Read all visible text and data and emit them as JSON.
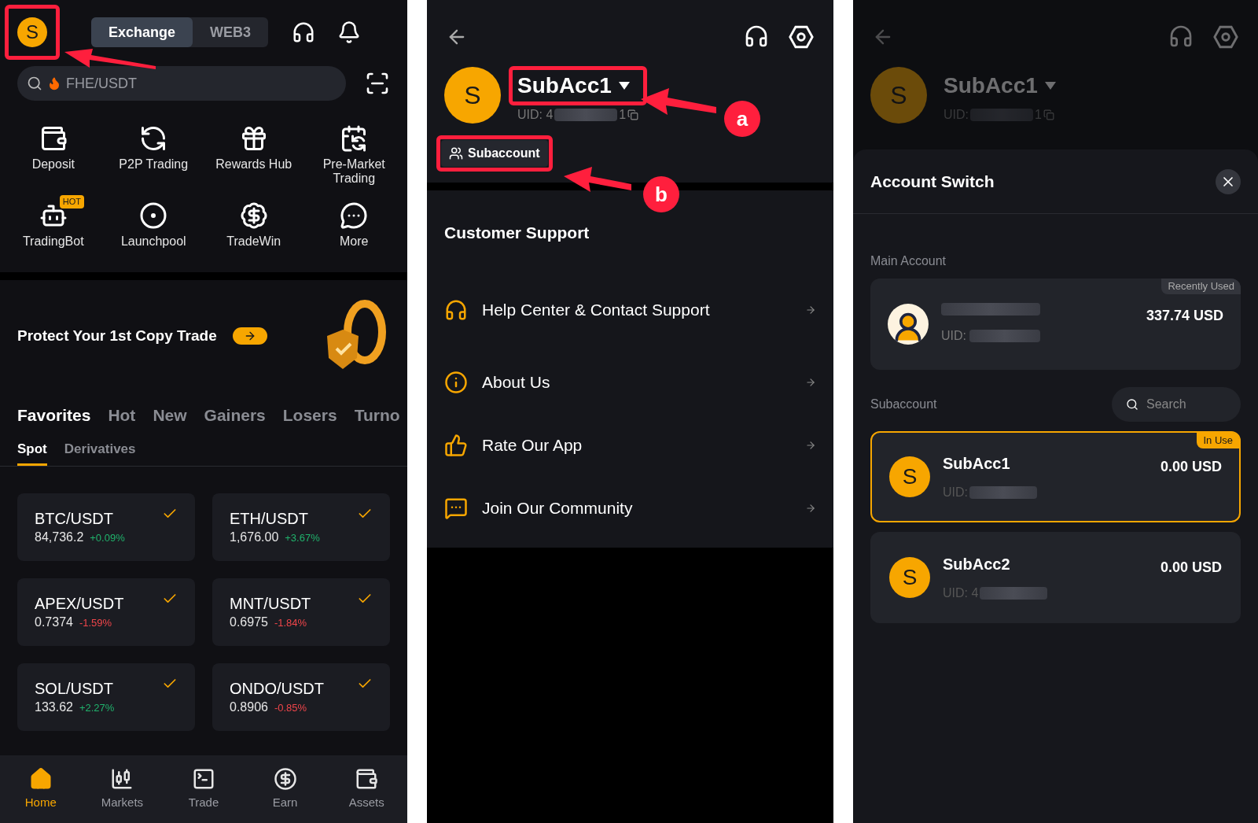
{
  "home": {
    "avatar_letter": "S",
    "mode_tabs": [
      {
        "label": "Exchange",
        "selected": true
      },
      {
        "label": "WEB3",
        "selected": false
      }
    ],
    "search": {
      "placeholder": "FHE/USDT"
    },
    "quick_actions": [
      {
        "label": "Deposit"
      },
      {
        "label": "P2P Trading"
      },
      {
        "label": "Rewards Hub"
      },
      {
        "label": "Pre-Market Trading"
      },
      {
        "label": "TradingBot",
        "badge": "HOT"
      },
      {
        "label": "Launchpool"
      },
      {
        "label": "TradeWin"
      },
      {
        "label": "More"
      }
    ],
    "banner": {
      "text": "Protect Your 1st Copy Trade"
    },
    "market_tabs": [
      {
        "label": "Favorites",
        "selected": true
      },
      {
        "label": "Hot",
        "selected": false
      },
      {
        "label": "New",
        "selected": false
      },
      {
        "label": "Gainers",
        "selected": false
      },
      {
        "label": "Losers",
        "selected": false
      },
      {
        "label": "Turno",
        "selected": false
      }
    ],
    "sub_tabs": [
      {
        "label": "Spot",
        "selected": true
      },
      {
        "label": "Derivatives",
        "selected": false
      }
    ],
    "pairs": [
      {
        "pair": "BTC/USDT",
        "price": "84,736.2",
        "change": "+0.09%",
        "color": "#20b26c",
        "favorite": true
      },
      {
        "pair": "ETH/USDT",
        "price": "1,676.00",
        "change": "+3.67%",
        "color": "#20b26c",
        "favorite": true
      },
      {
        "pair": "APEX/USDT",
        "price": "0.7374",
        "change": "-1.59%",
        "color": "#ef454a",
        "favorite": true
      },
      {
        "pair": "MNT/USDT",
        "price": "0.6975",
        "change": "-1.84%",
        "color": "#ef454a",
        "favorite": true
      },
      {
        "pair": "SOL/USDT",
        "price": "133.62",
        "change": "+2.27%",
        "color": "#20b26c",
        "favorite": true
      },
      {
        "pair": "ONDO/USDT",
        "price": "0.8906",
        "change": "-0.85%",
        "color": "#ef454a",
        "favorite": true
      }
    ],
    "nav": [
      {
        "label": "Home",
        "selected": true
      },
      {
        "label": "Markets",
        "selected": false
      },
      {
        "label": "Trade",
        "selected": false
      },
      {
        "label": "Earn",
        "selected": false
      },
      {
        "label": "Assets",
        "selected": false
      }
    ]
  },
  "profile": {
    "avatar_letter": "S",
    "name": "SubAcc1",
    "uid_prefix": "UID: 4",
    "uid_suffix": "1",
    "subaccount_button": "Subaccount",
    "section_title": "Customer Support",
    "menu": [
      {
        "label": "Help Center & Contact Support"
      },
      {
        "label": "About Us"
      },
      {
        "label": "Rate Our App"
      },
      {
        "label": "Join Our Community"
      }
    ]
  },
  "switch": {
    "header": {
      "avatar_letter": "S",
      "name": "SubAcc1",
      "uid_prefix": "UID:",
      "uid_suffix": "1"
    },
    "title": "Account Switch",
    "main_label": "Main Account",
    "main_account": {
      "badge": "Recently Used",
      "uid_label": "UID:",
      "balance": "337.74 USD"
    },
    "subaccount_label": "Subaccount",
    "search": {
      "placeholder": "Search"
    },
    "subaccounts": [
      {
        "avatar_letter": "S",
        "name": "SubAcc1",
        "uid_label": "UID:",
        "balance": "0.00 USD",
        "selected": true,
        "badge": "In Use"
      },
      {
        "avatar_letter": "S",
        "name": "SubAcc2",
        "uid_label": "UID: 4",
        "balance": "0.00 USD",
        "selected": false
      }
    ]
  },
  "annotations": {
    "labels": [
      "a",
      "b"
    ]
  }
}
